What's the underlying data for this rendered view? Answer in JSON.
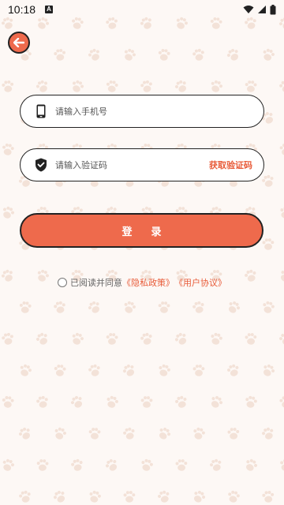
{
  "status_bar": {
    "time": "10:18",
    "notification_icon": "a-icon",
    "icons": [
      "wifi-icon",
      "signal-icon",
      "battery-icon"
    ]
  },
  "back_button": {
    "icon": "arrow-left-icon"
  },
  "phone_field": {
    "icon": "phone-icon",
    "placeholder": "请输入手机号",
    "value": ""
  },
  "code_field": {
    "icon": "shield-check-icon",
    "placeholder": "请输入验证码",
    "value": "",
    "get_code_label": "获取验证码"
  },
  "login_button": {
    "label": "登录"
  },
  "agreement": {
    "checked": false,
    "prefix": "已阅读并同意",
    "privacy_link": "《隐私政策》",
    "terms_link": "《用户协议》"
  },
  "colors": {
    "accent": "#ee6a4c",
    "link": "#e85c3a",
    "background": "#fdf8f5",
    "paw": "#f4e3da"
  }
}
